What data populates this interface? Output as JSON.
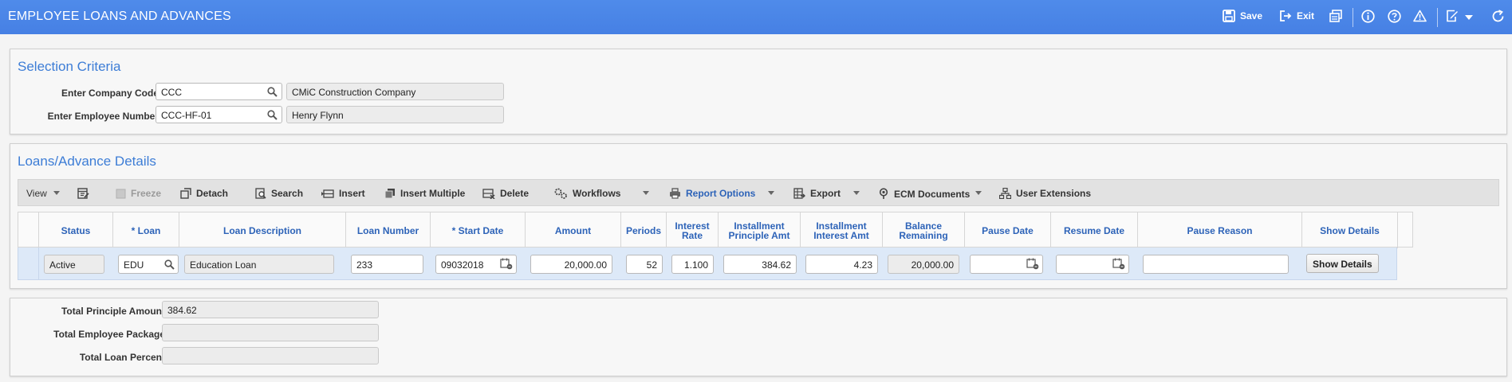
{
  "header": {
    "title": "EMPLOYEE LOANS AND ADVANCES",
    "save_label": "Save",
    "exit_label": "Exit"
  },
  "selection": {
    "title": "Selection Criteria",
    "company_label": "Enter Company Code",
    "company_value": "CCC",
    "company_name": "CMiC Construction Company",
    "employee_label": "Enter Employee Number",
    "employee_value": "CCC-HF-01",
    "employee_name": "Henry Flynn"
  },
  "loans": {
    "title": "Loans/Advance Details",
    "toolbar": {
      "view": "View",
      "freeze": "Freeze",
      "detach": "Detach",
      "search": "Search",
      "insert": "Insert",
      "insert_multiple": "Insert Multiple",
      "delete": "Delete",
      "workflows": "Workflows",
      "report_options": "Report Options",
      "export": "Export",
      "ecm_documents": "ECM Documents",
      "user_extensions": "User Extensions"
    },
    "columns": {
      "status": "Status",
      "loan": "* Loan",
      "loan_description": "Loan Description",
      "loan_number": "Loan Number",
      "start_date": "* Start Date",
      "amount": "Amount",
      "periods": "Periods",
      "interest_rate_1": "Interest",
      "interest_rate_2": "Rate",
      "installment_principle_1": "Installment",
      "installment_principle_2": "Principle Amt",
      "installment_interest_1": "Installment",
      "installment_interest_2": "Interest Amt",
      "balance_remaining_1": "Balance",
      "balance_remaining_2": "Remaining",
      "pause_date": "Pause Date",
      "resume_date": "Resume Date",
      "pause_reason": "Pause Reason",
      "show_details": "Show Details"
    },
    "row": {
      "status": "Active",
      "loan": "EDU",
      "loan_description": "Education Loan",
      "loan_number": "233",
      "start_date": "09032018",
      "amount": "20,000.00",
      "periods": "52",
      "interest_rate": "1.100",
      "installment_principle": "384.62",
      "installment_interest": "4.23",
      "balance_remaining": "20,000.00",
      "pause_date": "",
      "resume_date": "",
      "pause_reason": "",
      "show_details_button": "Show Details"
    }
  },
  "totals": {
    "principle_label": "Total Principle Amount",
    "principle_value": "384.62",
    "package_label": "Total Employee Package",
    "package_value": "",
    "percent_label": "Total Loan Percent",
    "percent_value": ""
  }
}
